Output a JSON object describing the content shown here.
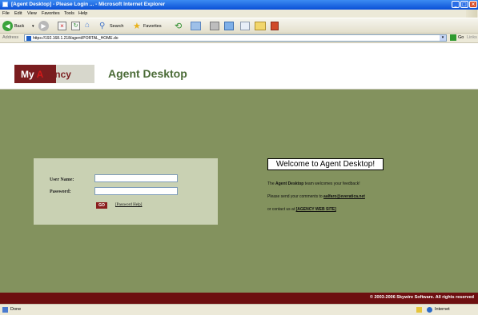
{
  "window": {
    "title": "[Agent Desktop] - Please Login ... - Microsoft Internet Explorer"
  },
  "menu": [
    "File",
    "Edit",
    "View",
    "Favorites",
    "Tools",
    "Help"
  ],
  "toolbar": {
    "back_label": "Back",
    "search_label": "Search",
    "favorites_label": "Favorites"
  },
  "address": {
    "label": "Address",
    "url": "https://192.168.1.218/agent/PORTAL_HOME.do",
    "go_label": "Go",
    "links_label": "Links"
  },
  "header": {
    "logo_text_1": "My ",
    "logo_text_2": "A",
    "logo_text_3": "gency",
    "title": "Agent Desktop"
  },
  "login": {
    "username_label": "User Name:",
    "username_value": "",
    "password_label": "Password:",
    "password_value": "",
    "go_label": "GO",
    "help_link": "[Password Help]"
  },
  "welcome": {
    "heading": "Welcome to Agent Desktop!",
    "line1_pre": "The ",
    "line1_bold": "Agent Desktop",
    "line1_post": " team welcomes your feedback!",
    "line2_pre": "Please send your comments to ",
    "line2_link": "aalfaro@everatica.net",
    "line3_pre": "or contact us at ",
    "line3_link": "[AGENCY WEB SITE]"
  },
  "footer": {
    "text": "© 2003-2006 Skywire Software. All rights reserved"
  },
  "status": {
    "left": "Done",
    "zone": "Internet"
  },
  "colors": {
    "green_bg": "#83925e",
    "login_panel": "#c9d1b3",
    "brand_maroon": "#6d0f10",
    "title_green": "#4b6b37"
  }
}
